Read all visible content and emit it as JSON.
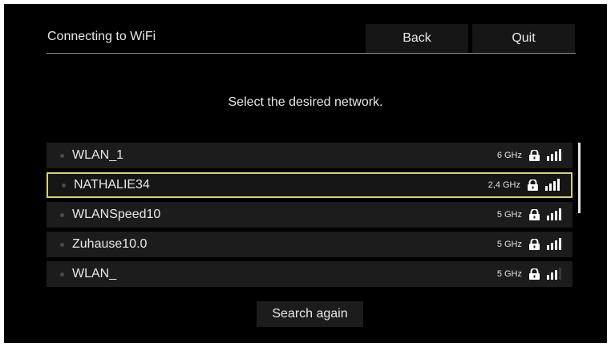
{
  "header": {
    "title": "Connecting to WiFi",
    "back_label": "Back",
    "quit_label": "Quit"
  },
  "prompt": "Select the desired network.",
  "networks": [
    {
      "ssid": "WLAN_1",
      "band": "6 GHz",
      "secured": true,
      "signal_bars": 4,
      "selected": false
    },
    {
      "ssid": "NATHALIE34",
      "band": "2,4 GHz",
      "secured": true,
      "signal_bars": 4,
      "selected": true
    },
    {
      "ssid": "WLANSpeed10",
      "band": "5 GHz",
      "secured": true,
      "signal_bars": 4,
      "selected": false
    },
    {
      "ssid": "Zuhause10.0",
      "band": "5 GHz",
      "secured": true,
      "signal_bars": 4,
      "selected": false
    },
    {
      "ssid": "WLAN_",
      "band": "5 GHz",
      "secured": true,
      "signal_bars": 3,
      "selected": false
    }
  ],
  "search_again_label": "Search again",
  "colors": {
    "background": "#000000",
    "row": "#1c1c1c",
    "selection_border": "#d9d36a",
    "text": "#e8e8e8"
  },
  "icons": {
    "lock": "lock-icon",
    "signal": "signal-strength-icon",
    "bullet": "bullet-icon"
  }
}
